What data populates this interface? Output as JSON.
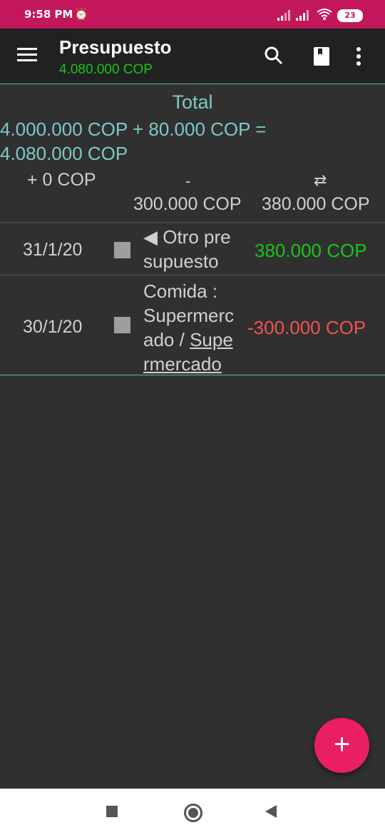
{
  "status": {
    "time": "9:58 PM",
    "battery": "23"
  },
  "appbar": {
    "title": "Presupuesto",
    "subtitle": "4.080.000 COP"
  },
  "summary": {
    "title": "Total",
    "formula_line1": "4.000.000 COP + 80.000 COP =",
    "formula_line2": "4.080.000 COP",
    "plus_label": "+ 0 COP",
    "minus_symbol": "-",
    "minus_value": "300.000 COP",
    "transfer_symbol": "⇄",
    "transfer_value": "380.000 COP"
  },
  "transactions": [
    {
      "date": "31/1/20",
      "desc_line1": "◀ Otro pre",
      "desc_line2": "supuesto",
      "amount": "380.000 COP"
    },
    {
      "date": "30/1/20",
      "desc_line1": "Comida :",
      "desc_line2": "Supermerc",
      "desc_line3_plain": "ado / ",
      "desc_line3_link": "Supe",
      "desc_line4_link": "rmercado",
      "amount": "-300.000 COP"
    }
  ],
  "fab": {
    "label": "+"
  },
  "colors": {
    "status_bar": "#c2185b",
    "positive": "#19c419",
    "negative": "#ef5350",
    "accent": "#e91e63",
    "summary_text": "#7ec8c8"
  }
}
